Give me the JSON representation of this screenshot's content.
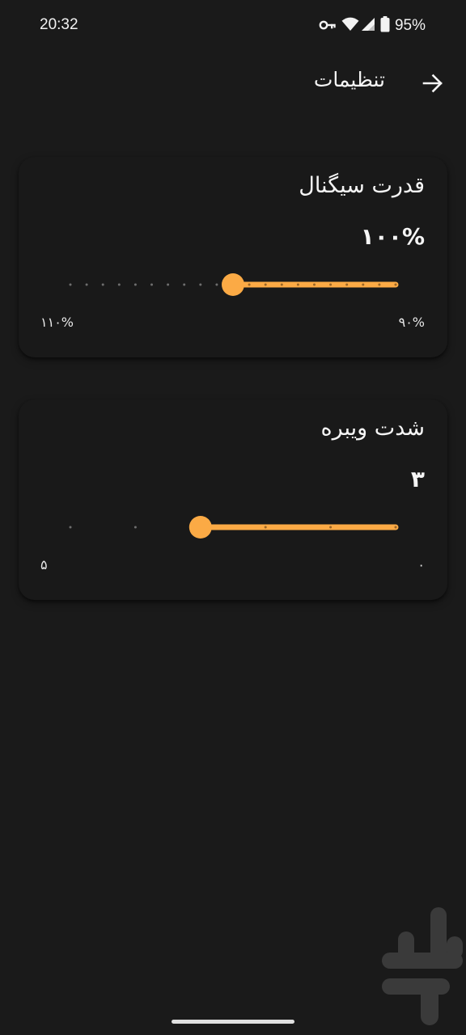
{
  "status_bar": {
    "time": "20:32",
    "battery_percent": "95%",
    "icons": [
      "vpn-key-icon",
      "wifi-icon",
      "cellular-signal-icon",
      "battery-icon"
    ]
  },
  "app_bar": {
    "title": "تنظیمات",
    "back_icon": "arrow-icon"
  },
  "settings": [
    {
      "title": "قدرت سیگنال",
      "value": "۱۰۰%",
      "slider": {
        "min_label": "۹۰%",
        "max_label": "۱۱۰%",
        "min": 90,
        "max": 110,
        "step": 1,
        "current": 100
      }
    },
    {
      "title": "شدت ویبره",
      "value": "۳",
      "slider": {
        "min_label": "۰",
        "max_label": "۵",
        "min": 0,
        "max": 5,
        "step": 1,
        "current": 3
      }
    }
  ],
  "colors": {
    "accent": "#FBAA45",
    "background": "#1A1A1A",
    "card": "#191919",
    "inactive_tick": "#6E6E6E",
    "active_tick": "#9A6525"
  },
  "watermark_icon": "cafebazaar-logo-icon"
}
